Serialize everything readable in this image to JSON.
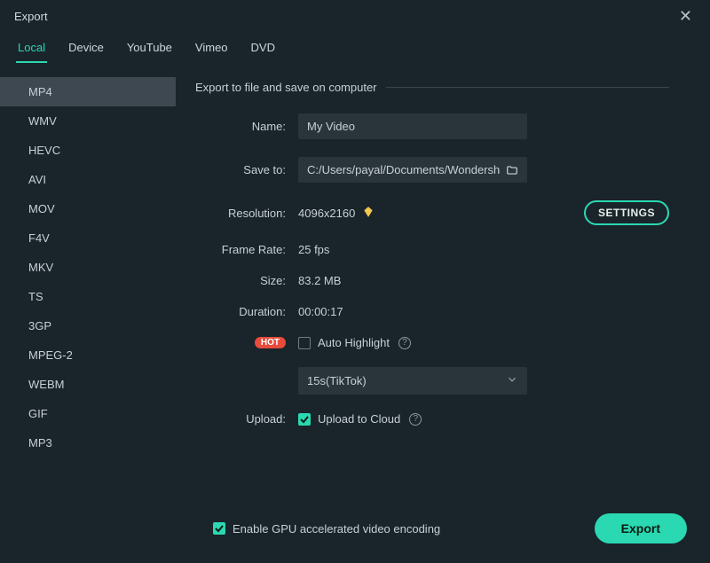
{
  "window": {
    "title": "Export"
  },
  "tabs": [
    "Local",
    "Device",
    "YouTube",
    "Vimeo",
    "DVD"
  ],
  "active_tab": "Local",
  "formats": [
    "MP4",
    "WMV",
    "HEVC",
    "AVI",
    "MOV",
    "F4V",
    "MKV",
    "TS",
    "3GP",
    "MPEG-2",
    "WEBM",
    "GIF",
    "MP3"
  ],
  "active_format": "MP4",
  "section_title": "Export to file and save on computer",
  "fields": {
    "name_label": "Name:",
    "name_value": "My Video",
    "saveto_label": "Save to:",
    "saveto_value": "C:/Users/payal/Documents/Wondershare/",
    "resolution_label": "Resolution:",
    "resolution_value": "4096x2160",
    "settings_button": "SETTINGS",
    "framerate_label": "Frame Rate:",
    "framerate_value": "25 fps",
    "size_label": "Size:",
    "size_value": "83.2 MB",
    "duration_label": "Duration:",
    "duration_value": "00:00:17",
    "hot_badge": "HOT",
    "auto_highlight_label": "Auto Highlight",
    "auto_highlight_checked": false,
    "preset_select_value": "15s(TikTok)",
    "upload_label": "Upload:",
    "upload_cloud_label": "Upload to Cloud",
    "upload_cloud_checked": true
  },
  "footer": {
    "gpu_label": "Enable GPU accelerated video encoding",
    "gpu_checked": true,
    "export_button": "Export"
  }
}
